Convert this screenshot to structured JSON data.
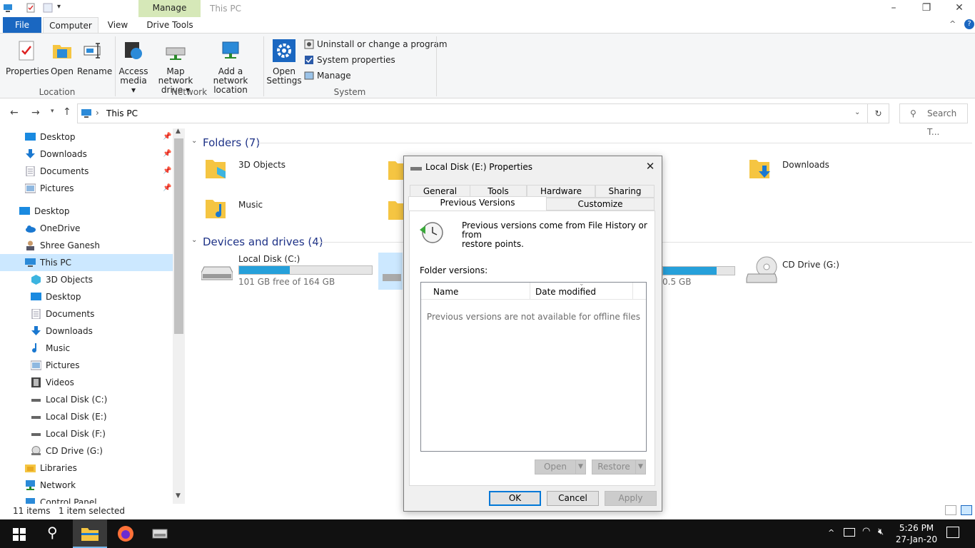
{
  "window": {
    "title": "This PC",
    "context_tab": "Manage"
  },
  "ribbon": {
    "tabs": [
      "File",
      "Computer",
      "View",
      "Drive Tools"
    ],
    "location_group": "Location",
    "network_group": "Network",
    "system_group": "System",
    "buttons": {
      "properties": "Properties",
      "open": "Open",
      "rename": "Rename",
      "access_media_1": "Access",
      "access_media_2": "media",
      "map_drive_1": "Map network",
      "map_drive_2": "drive",
      "add_location_1": "Add a network",
      "add_location_2": "location",
      "open_settings_1": "Open",
      "open_settings_2": "Settings"
    },
    "small_cmds": {
      "uninstall": "Uninstall or change a program",
      "sysprops": "System properties",
      "manage": "Manage"
    }
  },
  "address": {
    "path": "This PC",
    "search_placeholder": "Search T..."
  },
  "nav": {
    "quick": [
      "Desktop",
      "Downloads",
      "Documents",
      "Pictures"
    ],
    "desktop": "Desktop",
    "onedrive": "OneDrive",
    "user": "Shree Ganesh",
    "thispc": "This PC",
    "pc_children": [
      "3D Objects",
      "Desktop",
      "Documents",
      "Downloads",
      "Music",
      "Pictures",
      "Videos",
      "Local Disk (C:)",
      "Local Disk (E:)",
      "Local Disk (F:)",
      "CD Drive (G:)"
    ],
    "libraries": "Libraries",
    "network": "Network",
    "control_panel": "Control Panel"
  },
  "content": {
    "folders_header": "Folders (7)",
    "folders": {
      "objects3d": "3D Objects",
      "downloads": "Downloads",
      "music": "Music"
    },
    "devices_header": "Devices and drives (4)",
    "drive_c": {
      "name": "Local Disk (C:)",
      "free": "101 GB free of 164 GB",
      "used_fraction": 0.38
    },
    "drive_f_partial": {
      "free_tail": "0.5 GB",
      "used_fraction": 0.75
    },
    "cd_drive": "CD Drive (G:)"
  },
  "status": {
    "items": "11 items",
    "selected": "1 item selected"
  },
  "taskbar": {
    "time": "5:26 PM",
    "date": "27-Jan-20"
  },
  "dialog": {
    "title": "Local Disk (E:) Properties",
    "tabs_row1": [
      "General",
      "Tools",
      "Hardware",
      "Sharing"
    ],
    "tabs_row2": [
      "Previous Versions",
      "Customize"
    ],
    "info_1": "Previous versions come from File History or from",
    "info_2": "restore points.",
    "folder_versions_label": "Folder versions:",
    "col_name": "Name",
    "col_date": "Date modified",
    "empty_message": "Previous versions are not available for offline files",
    "open_btn": "Open",
    "restore_btn": "Restore",
    "ok": "OK",
    "cancel": "Cancel",
    "apply": "Apply"
  },
  "colors": {
    "accent": "#1a67c1",
    "drive_bar": "#26a0da",
    "selected_nav": "#cce8ff",
    "manage_tab": "#d6e8b8"
  }
}
